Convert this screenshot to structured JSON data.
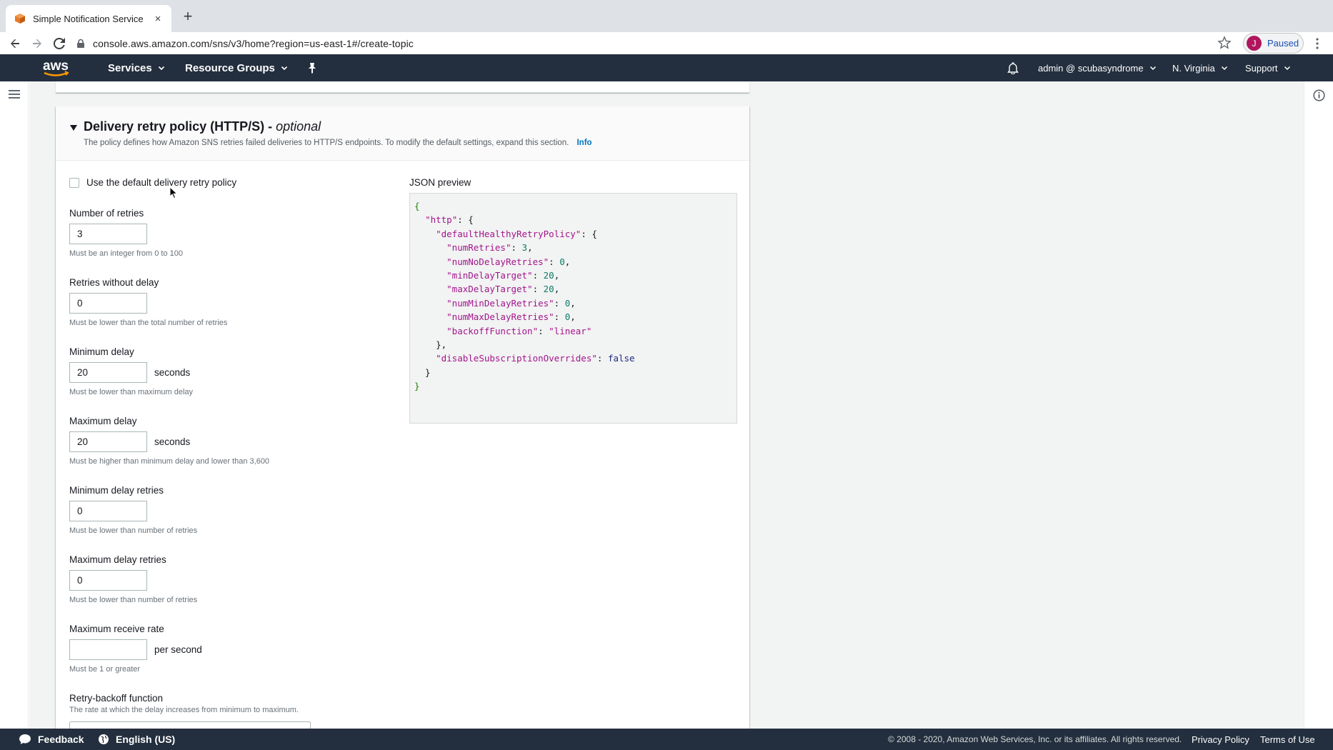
{
  "browser": {
    "tab_title": "Simple Notification Service",
    "tab_close": "×",
    "new_tab": "+",
    "url": "console.aws.amazon.com/sns/v3/home?region=us-east-1#/create-topic",
    "profile_initial": "J",
    "profile_status": "Paused"
  },
  "aws_header": {
    "services": "Services",
    "resource_groups": "Resource Groups",
    "account": "admin @ scubasyndrome",
    "region": "N. Virginia",
    "support": "Support"
  },
  "panel": {
    "title": "Delivery retry policy (HTTP/S) - ",
    "title_optional": "optional",
    "description": "The policy defines how Amazon SNS retries failed deliveries to HTTP/S endpoints. To modify the default settings, expand this section.",
    "info_link": "Info",
    "use_default_label": "Use the default delivery retry policy",
    "json_preview_label": "JSON preview"
  },
  "fields": {
    "num_retries": {
      "label": "Number of retries",
      "value": "3",
      "hint": "Must be an integer from 0 to 100"
    },
    "retries_without_delay": {
      "label": "Retries without delay",
      "value": "0",
      "hint": "Must be lower than the total number of retries"
    },
    "min_delay": {
      "label": "Minimum delay",
      "value": "20",
      "unit": "seconds",
      "hint": "Must be lower than maximum delay"
    },
    "max_delay": {
      "label": "Maximum delay",
      "value": "20",
      "unit": "seconds",
      "hint": "Must be higher than minimum delay and lower than 3,600"
    },
    "min_delay_retries": {
      "label": "Minimum delay retries",
      "value": "0",
      "hint": "Must be lower than number of retries"
    },
    "max_delay_retries": {
      "label": "Maximum delay retries",
      "value": "0",
      "hint": "Must be lower than number of retries"
    },
    "max_receive_rate": {
      "label": "Maximum receive rate",
      "value": "",
      "unit": "per second",
      "hint": "Must be 1 or greater"
    },
    "backoff_function": {
      "label": "Retry-backoff function",
      "hint": "The rate at which the delay increases from minimum to maximum."
    }
  },
  "json_preview": {
    "open_brace": "{",
    "close_brace": "}",
    "http_key": "\"http\"",
    "policy_key": "\"defaultHealthyRetryPolicy\"",
    "num_retries_key": "\"numRetries\"",
    "num_retries_val": "3",
    "num_no_delay_key": "\"numNoDelayRetries\"",
    "num_no_delay_val": "0",
    "min_delay_key": "\"minDelayTarget\"",
    "min_delay_val": "20",
    "max_delay_key": "\"maxDelayTarget\"",
    "max_delay_val": "20",
    "num_min_delay_key": "\"numMinDelayRetries\"",
    "num_min_delay_val": "0",
    "num_max_delay_key": "\"numMaxDelayRetries\"",
    "num_max_delay_val": "0",
    "backoff_key": "\"backoffFunction\"",
    "backoff_val": "\"linear\"",
    "disable_key": "\"disableSubscriptionOverrides\"",
    "disable_val": "false"
  },
  "footer": {
    "feedback": "Feedback",
    "language": "English (US)",
    "copyright": "© 2008 - 2020, Amazon Web Services, Inc. or its affiliates. All rights reserved.",
    "privacy": "Privacy Policy",
    "terms": "Terms of Use"
  },
  "colors": {
    "aws_nav_bg": "#232f3e",
    "link_blue": "#0073bb",
    "page_bg": "#f2f3f3"
  }
}
